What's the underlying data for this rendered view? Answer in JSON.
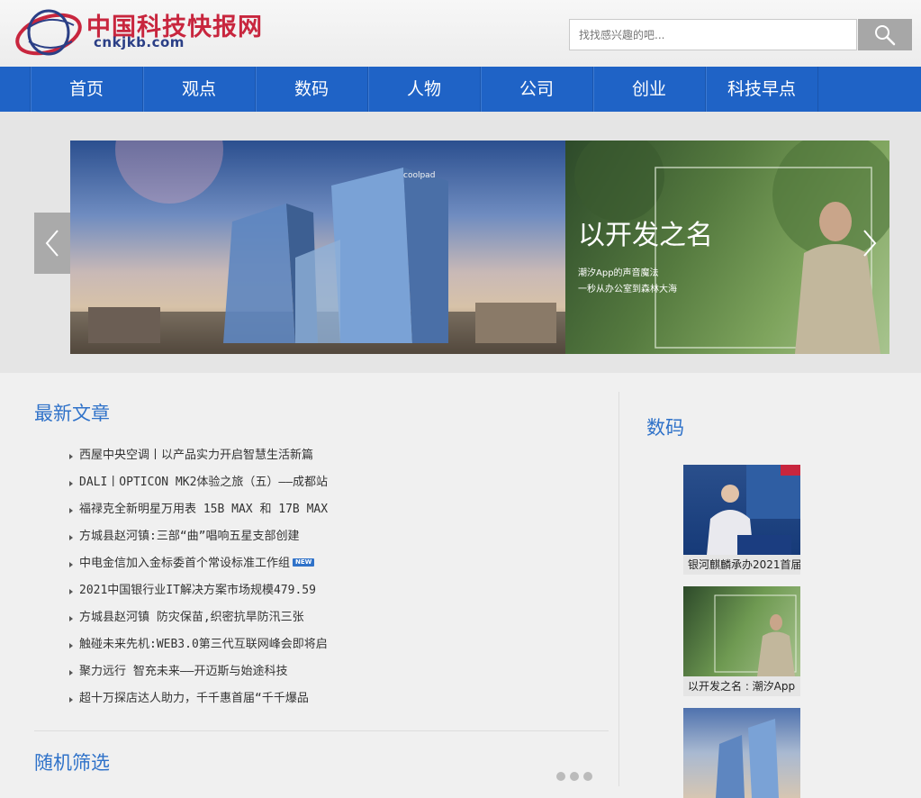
{
  "header": {
    "logo_text": "中国科技快报网",
    "logo_domain": "cnkjkb.com",
    "search_placeholder": "找找感兴趣的吧...",
    "search_icon": "search-icon"
  },
  "nav": {
    "items": [
      "首页",
      "观点",
      "数码",
      "人物",
      "公司",
      "创业",
      "科技早点"
    ]
  },
  "banner": {
    "building_sign": "coolpad",
    "slide_title": "以开发之名",
    "slide_line1": "潮汐App的声音魔法",
    "slide_line2": "一秒从办公室到森林大海",
    "prev_icon": "chevron-left-icon",
    "next_icon": "chevron-right-icon"
  },
  "latest": {
    "title": "最新文章",
    "new_label": "NEW",
    "articles": [
      "西屋中央空调丨以产品实力开启智慧生活新篇",
      "DALI丨OPTICON MK2体验之旅（五）——成都站",
      "福禄克全新明星万用表 15B MAX 和 17B MAX",
      "方城县赵河镇:三部“曲”唱响五星支部创建",
      "中电金信加入金标委首个常设标准工作组",
      "2021中国银行业IT解决方案市场规模479.59",
      "方城县赵河镇 防灾保苗,织密抗旱防汛三张",
      "触碰未来先机:WEB3.0第三代互联网峰会即将启",
      "聚力远行 智充未来——开迈斯与始途科技",
      "超十万探店达人助力，千千惠首届“千千爆品"
    ]
  },
  "random": {
    "title": "随机筛选"
  },
  "digital": {
    "title": "数码",
    "items": [
      {
        "caption": "银河麒麟承办2021首届"
      },
      {
        "caption": "以开发之名 : 潮汐App"
      },
      {
        "caption": ""
      }
    ]
  }
}
